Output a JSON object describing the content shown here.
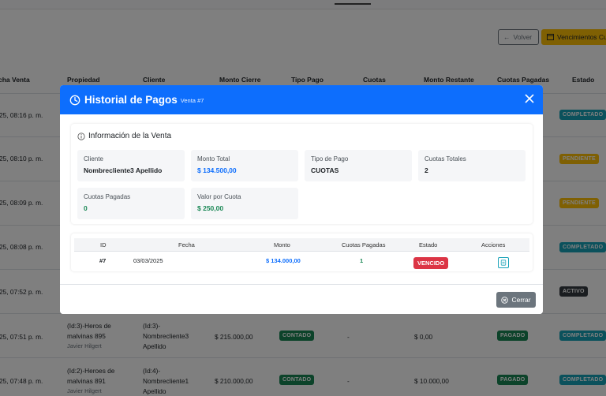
{
  "toolbar": {
    "volver_label": "Volver",
    "vencimientos_label": "Vencimientos Cu"
  },
  "table": {
    "headers": [
      "cha Venta",
      "Propiedad",
      "Cliente",
      "Monto Cierre",
      "Tipo Pago",
      "Cuotas",
      "Monto Restante",
      "Cuotas Pagadas",
      "Estado"
    ],
    "rows": [
      {
        "fecha": "25, 08:16 p. m.",
        "estado": "COMPLETADO"
      },
      {
        "fecha": "25, 08:10 p. m.",
        "estado": "PENDIENTE"
      },
      {
        "fecha": "25, 08:09 p. m.",
        "estado": "PENDIENTE"
      },
      {
        "fecha": "25, 08:08 p. m.",
        "estado": "COMPLETADO"
      },
      {
        "fecha": "25, 07:52 p. m.",
        "estado": "ACTIVO"
      },
      {
        "fecha": "25, 07:51 p. m.",
        "propiedad": "(Id:3)-Heros de",
        "propiedad2": "malvinas 895",
        "vendedor": "Javier Hilgert",
        "cliente": "(Id:3)-",
        "cliente2": "Nombrecliente3",
        "cliente3": "Apellido",
        "monto": "$ 215.000,00",
        "tipo": "CONTADO",
        "cuotas": "-",
        "restante": "$ 0,00",
        "pagadas": "PAGADO",
        "estado": "COMPLETADO"
      },
      {
        "fecha": "25, 07:48 p. m.",
        "propiedad": "(Id:2)-Heroes de",
        "propiedad2": "malvinas 891",
        "vendedor": "Javier Hilgert",
        "cliente": "(Id:4)-",
        "cliente2": "Nombrecliente1",
        "cliente3": "Apellido",
        "monto": "$ 210.000,00",
        "tipo": "CONTADO",
        "cuotas": "-",
        "restante": "$ 10.000,00",
        "pagadas": "PAGADO",
        "estado": "COMPLETADO"
      }
    ]
  },
  "modal": {
    "title": "Historial de Pagos",
    "subtitle": "Venta #7",
    "info_title": "Información de la Venta",
    "fields": {
      "cliente_label": "Cliente",
      "cliente_value": "Nombrecliente3 Apellido",
      "monto_label": "Monto Total",
      "monto_value": "$ 134.500,00",
      "tipo_label": "Tipo de Pago",
      "tipo_value": "CUOTAS",
      "cuotas_totales_label": "Cuotas Totales",
      "cuotas_totales_value": "2",
      "cuotas_pagadas_label": "Cuotas Pagadas",
      "cuotas_pagadas_value": "0",
      "valor_cuota_label": "Valor por Cuota",
      "valor_cuota_value": "$ 250,00"
    },
    "payments": {
      "headers": {
        "id": "ID",
        "fecha": "Fecha",
        "monto": "Monto",
        "cuotas": "Cuotas Pagadas",
        "estado": "Estado",
        "acciones": "Acciones"
      },
      "row": {
        "id": "#7",
        "fecha": "03/03/2025",
        "monto": "$ 134.000,00",
        "cuotas": "1",
        "estado": "VENCIDO"
      }
    },
    "close_label": "Cerrar"
  },
  "colors": {
    "primary": "#0d6efd",
    "info": "#17a2b8",
    "warning": "#ffc107",
    "success": "#198754",
    "danger": "#dc3545",
    "secondary": "#6c757d"
  }
}
